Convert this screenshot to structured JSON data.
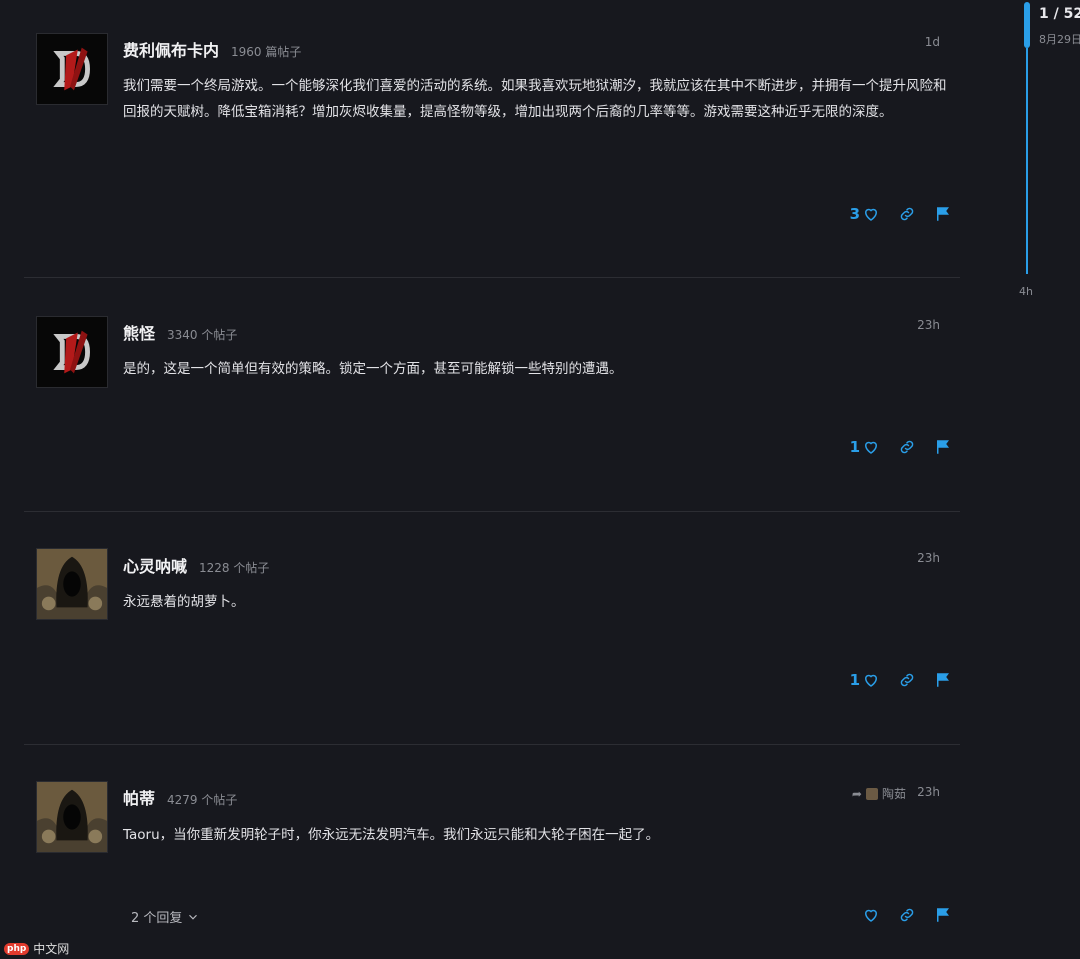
{
  "timeline": {
    "count": "1 / 52",
    "date": "8月29日",
    "end_label": "4h",
    "progress": 0.0
  },
  "posts": [
    {
      "username": "费利佩布卡内",
      "post_count": "1960 篇帖子",
      "time": "1d",
      "avatar": "diablo-logo",
      "content": "我们需要一个终局游戏。一个能够深化我们喜爱的活动的系统。如果我喜欢玩地狱潮汐，我就应该在其中不断进步，并拥有一个提升风险和回报的天赋树。降低宝箱消耗？增加灰烬收集量，提高怪物等级，增加出现两个后裔的几率等等。游戏需要这种近乎无限的深度。",
      "likes": "3"
    },
    {
      "username": "熊怪",
      "post_count": "3340 个帖子",
      "time": "23h",
      "avatar": "diablo-logo",
      "content": "是的，这是一个简单但有效的策略。锁定一个方面，甚至可能解锁一些特别的遭遇。",
      "likes": "1"
    },
    {
      "username": "心灵呐喊",
      "post_count": "1228 个帖子",
      "time": "23h",
      "avatar": "hooded-figure",
      "content": "永远悬着的胡萝卜。",
      "likes": "1"
    },
    {
      "username": "帕蒂",
      "post_count": "4279 个帖子",
      "time": "23h",
      "avatar": "hooded-figure",
      "reply_to": "陶茹",
      "content": "Taoru，当你重新发明轮子时，你永远无法发明汽车。我们永远只能和大轮子困在一起了。",
      "likes": "",
      "replies": "2 个回复"
    }
  ],
  "watermark": {
    "badge": "php",
    "text": "中文网"
  },
  "colors": {
    "background": "#17181e",
    "accent": "#2a9ee8",
    "muted": "#8a8c93",
    "divider": "#2c2d33"
  }
}
